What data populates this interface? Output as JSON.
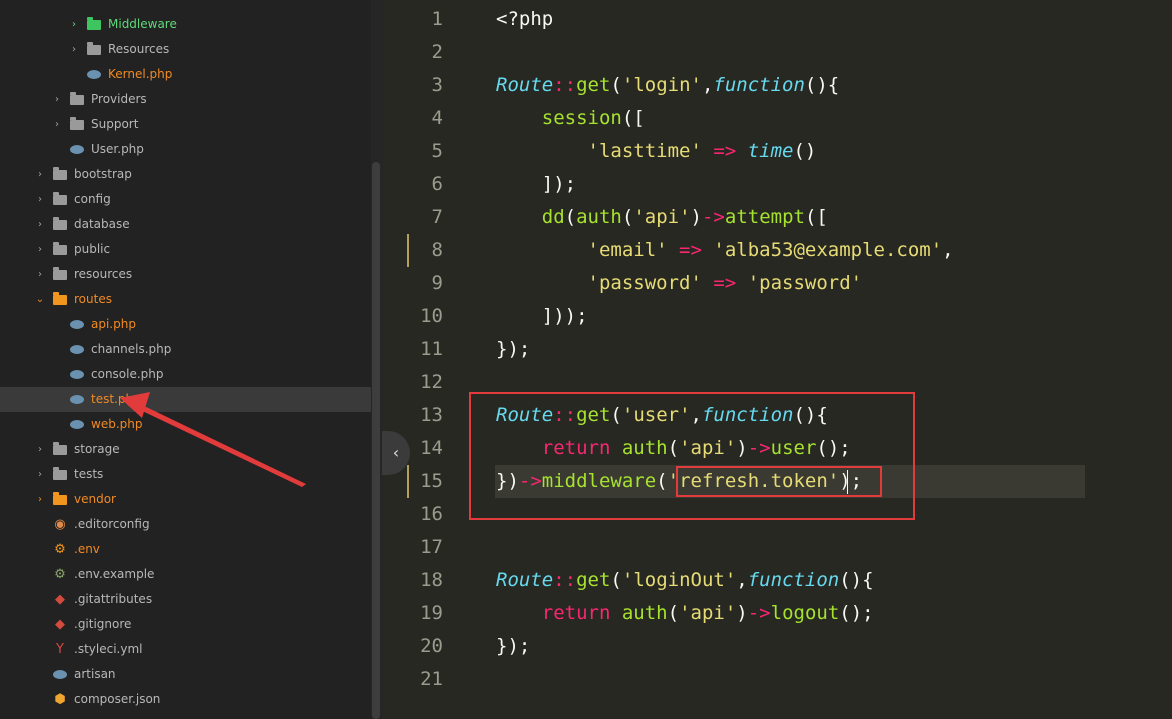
{
  "sidebar": {
    "items": [
      {
        "label": "Middleware",
        "type": "folder",
        "color": "green",
        "chevron": true
      },
      {
        "label": "Resources",
        "type": "folder",
        "color": "gray",
        "chevron": true
      },
      {
        "label": "Kernel.php",
        "type": "php",
        "color": "orange",
        "chevron": false
      },
      {
        "label": "Providers",
        "type": "folder",
        "color": "gray",
        "chevron": true
      },
      {
        "label": "Support",
        "type": "folder",
        "color": "gray",
        "chevron": true
      },
      {
        "label": "User.php",
        "type": "php",
        "color": "gray",
        "chevron": false
      },
      {
        "label": "bootstrap",
        "type": "folder",
        "color": "gray",
        "chevron": true
      },
      {
        "label": "config",
        "type": "folder",
        "color": "gray",
        "chevron": true
      },
      {
        "label": "database",
        "type": "folder",
        "color": "gray",
        "chevron": true
      },
      {
        "label": "public",
        "type": "folder",
        "color": "gray",
        "chevron": true
      },
      {
        "label": "resources",
        "type": "folder",
        "color": "gray",
        "chevron": true
      },
      {
        "label": "routes",
        "type": "folder-open",
        "color": "orange",
        "chevron": true
      },
      {
        "label": "api.php",
        "type": "php",
        "color": "orange",
        "chevron": false
      },
      {
        "label": "channels.php",
        "type": "php",
        "color": "gray",
        "chevron": false
      },
      {
        "label": "console.php",
        "type": "php",
        "color": "gray",
        "chevron": false
      },
      {
        "label": "test.php",
        "type": "php",
        "color": "orange",
        "chevron": false,
        "selected": true
      },
      {
        "label": "web.php",
        "type": "php",
        "color": "orange",
        "chevron": false
      },
      {
        "label": "storage",
        "type": "folder",
        "color": "gray",
        "chevron": true
      },
      {
        "label": "tests",
        "type": "folder",
        "color": "gray",
        "chevron": true
      },
      {
        "label": "vendor",
        "type": "folder",
        "color": "orange",
        "chevron": true
      },
      {
        "label": ".editorconfig",
        "type": "editorconfig",
        "color": "gray",
        "chevron": false
      },
      {
        "label": ".env",
        "type": "gear",
        "color": "orange",
        "chevron": false
      },
      {
        "label": ".env.example",
        "type": "gear",
        "color": "gray",
        "chevron": false
      },
      {
        "label": ".gitattributes",
        "type": "git",
        "color": "gray",
        "chevron": false
      },
      {
        "label": ".gitignore",
        "type": "git",
        "color": "gray",
        "chevron": false
      },
      {
        "label": ".styleci.yml",
        "type": "yml",
        "color": "gray",
        "chevron": false
      },
      {
        "label": "artisan",
        "type": "php",
        "color": "gray",
        "chevron": false
      },
      {
        "label": "composer.json",
        "type": "json",
        "color": "gray",
        "chevron": false
      }
    ]
  },
  "editor": {
    "line_numbers": [
      "1",
      "2",
      "3",
      "4",
      "5",
      "6",
      "7",
      "8",
      "9",
      "10",
      "11",
      "12",
      "13",
      "14",
      "15",
      "16",
      "17",
      "18",
      "19",
      "20",
      "21"
    ],
    "lines": [
      [
        [
          "k-plain",
          "<?php"
        ]
      ],
      [],
      [
        [
          "k-class",
          "Route"
        ],
        [
          "k-op",
          "::"
        ],
        [
          "k-fn",
          "get"
        ],
        [
          "k-plain",
          "("
        ],
        [
          "k-str",
          "'login'"
        ],
        [
          "k-plain",
          ","
        ],
        [
          "k-kw",
          "function"
        ],
        [
          "k-plain",
          "(){"
        ]
      ],
      [
        [
          "k-plain",
          "    "
        ],
        [
          "k-fn",
          "session"
        ],
        [
          "k-plain",
          "(["
        ]
      ],
      [
        [
          "k-plain",
          "        "
        ],
        [
          "k-str",
          "'lasttime'"
        ],
        [
          "k-plain",
          " "
        ],
        [
          "k-op",
          "=>"
        ],
        [
          "k-plain",
          " "
        ],
        [
          "k-class",
          "time"
        ],
        [
          "k-plain",
          "()"
        ]
      ],
      [
        [
          "k-plain",
          "    ]);"
        ]
      ],
      [
        [
          "k-plain",
          "    "
        ],
        [
          "k-fn",
          "dd"
        ],
        [
          "k-plain",
          "("
        ],
        [
          "k-fn",
          "auth"
        ],
        [
          "k-plain",
          "("
        ],
        [
          "k-str",
          "'api'"
        ],
        [
          "k-plain",
          ")"
        ],
        [
          "k-op",
          "->"
        ],
        [
          "k-fn",
          "attempt"
        ],
        [
          "k-plain",
          "(["
        ]
      ],
      [
        [
          "k-plain",
          "        "
        ],
        [
          "k-str",
          "'email'"
        ],
        [
          "k-plain",
          " "
        ],
        [
          "k-op",
          "=>"
        ],
        [
          "k-plain",
          " "
        ],
        [
          "k-str",
          "'alba53@example.com'"
        ],
        [
          "k-plain",
          ","
        ]
      ],
      [
        [
          "k-plain",
          "        "
        ],
        [
          "k-str",
          "'password'"
        ],
        [
          "k-plain",
          " "
        ],
        [
          "k-op",
          "=>"
        ],
        [
          "k-plain",
          " "
        ],
        [
          "k-str",
          "'password'"
        ]
      ],
      [
        [
          "k-plain",
          "    ]));"
        ]
      ],
      [
        [
          "k-plain",
          "});"
        ]
      ],
      [],
      [
        [
          "k-class",
          "Route"
        ],
        [
          "k-op",
          "::"
        ],
        [
          "k-fn",
          "get"
        ],
        [
          "k-plain",
          "("
        ],
        [
          "k-str",
          "'user'"
        ],
        [
          "k-plain",
          ","
        ],
        [
          "k-kw",
          "function"
        ],
        [
          "k-plain",
          "(){"
        ]
      ],
      [
        [
          "k-plain",
          "    "
        ],
        [
          "k-ret",
          "return"
        ],
        [
          "k-plain",
          " "
        ],
        [
          "k-fn",
          "auth"
        ],
        [
          "k-plain",
          "("
        ],
        [
          "k-str",
          "'api'"
        ],
        [
          "k-plain",
          ")"
        ],
        [
          "k-op",
          "->"
        ],
        [
          "k-fn",
          "user"
        ],
        [
          "k-plain",
          "();"
        ]
      ],
      [
        [
          "k-plain",
          "})"
        ],
        [
          "k-op",
          "->"
        ],
        [
          "k-fn",
          "middleware"
        ],
        [
          "k-plain",
          "("
        ],
        [
          "k-str",
          "'refresh.token'"
        ],
        [
          "k-plain",
          ");"
        ]
      ],
      [],
      [],
      [
        [
          "k-class",
          "Route"
        ],
        [
          "k-op",
          "::"
        ],
        [
          "k-fn",
          "get"
        ],
        [
          "k-plain",
          "("
        ],
        [
          "k-str",
          "'loginOut'"
        ],
        [
          "k-plain",
          ","
        ],
        [
          "k-kw",
          "function"
        ],
        [
          "k-plain",
          "(){"
        ]
      ],
      [
        [
          "k-plain",
          "    "
        ],
        [
          "k-ret",
          "return"
        ],
        [
          "k-plain",
          " "
        ],
        [
          "k-fn",
          "auth"
        ],
        [
          "k-plain",
          "("
        ],
        [
          "k-str",
          "'api'"
        ],
        [
          "k-plain",
          ")"
        ],
        [
          "k-op",
          "->"
        ],
        [
          "k-fn",
          "logout"
        ],
        [
          "k-plain",
          "();"
        ]
      ],
      [
        [
          "k-plain",
          "});"
        ]
      ],
      []
    ]
  },
  "icons": {
    "toggle": "chevron-left-icon",
    "annotation": "red-arrow"
  },
  "colors": {
    "annotation": "#e23b3b",
    "background": "#272822",
    "sidebar": "#222222"
  }
}
